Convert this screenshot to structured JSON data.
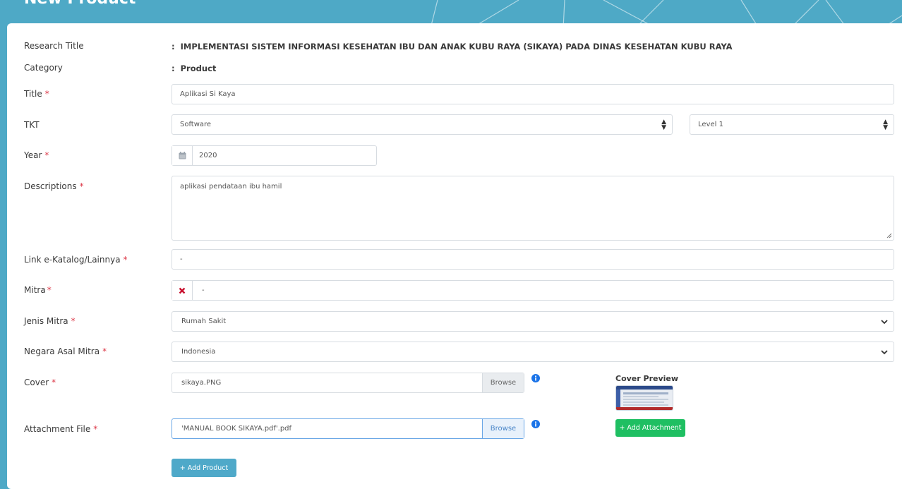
{
  "page": {
    "title": "New Product"
  },
  "form": {
    "research_title": {
      "label": "Research Title",
      "value": "IMPLEMENTASI SISTEM INFORMASI KESEHATAN IBU DAN ANAK KUBU RAYA (SIKAYA) PADA DINAS KESEHATAN KUBU RAYA"
    },
    "category": {
      "label": "Category",
      "value": "Product"
    },
    "title": {
      "label": "Title",
      "value": "Aplikasi Si Kaya"
    },
    "tkt": {
      "label": "TKT",
      "type_value": "Software",
      "level_value": "Level 1"
    },
    "year": {
      "label": "Year",
      "value": "2020",
      "icon": "calendar-icon"
    },
    "descriptions": {
      "label": "Descriptions",
      "value": "aplikasi pendataan ibu hamil"
    },
    "link": {
      "label": "Link e-Katalog/Lainnya",
      "value": "-"
    },
    "mitra": {
      "label": "Mitra",
      "value": "-",
      "icon": "clear-x-icon"
    },
    "jenis_mitra": {
      "label": "Jenis Mitra",
      "value": "Rumah Sakit"
    },
    "negara_asal_mitra": {
      "label": "Negara Asal Mitra",
      "value": "Indonesia"
    },
    "cover": {
      "label": "Cover",
      "file_name": "sikaya.PNG",
      "browse_label": "Browse"
    },
    "attachment": {
      "label": "Attachment File",
      "file_name": "'MANUAL BOOK SIKAYA.pdf'.pdf",
      "browse_label": "Browse"
    },
    "cover_preview": {
      "title": "Cover Preview"
    },
    "required_mark": "*"
  },
  "buttons": {
    "add_attachment": "+ Add Attachment",
    "add_product": "+ Add Product"
  },
  "colors": {
    "header": "#4ea9c6",
    "required": "#dc3545",
    "green_button": "#1fbf62",
    "blue_button": "#4fa9c9",
    "info_icon": "#1a73e8"
  }
}
